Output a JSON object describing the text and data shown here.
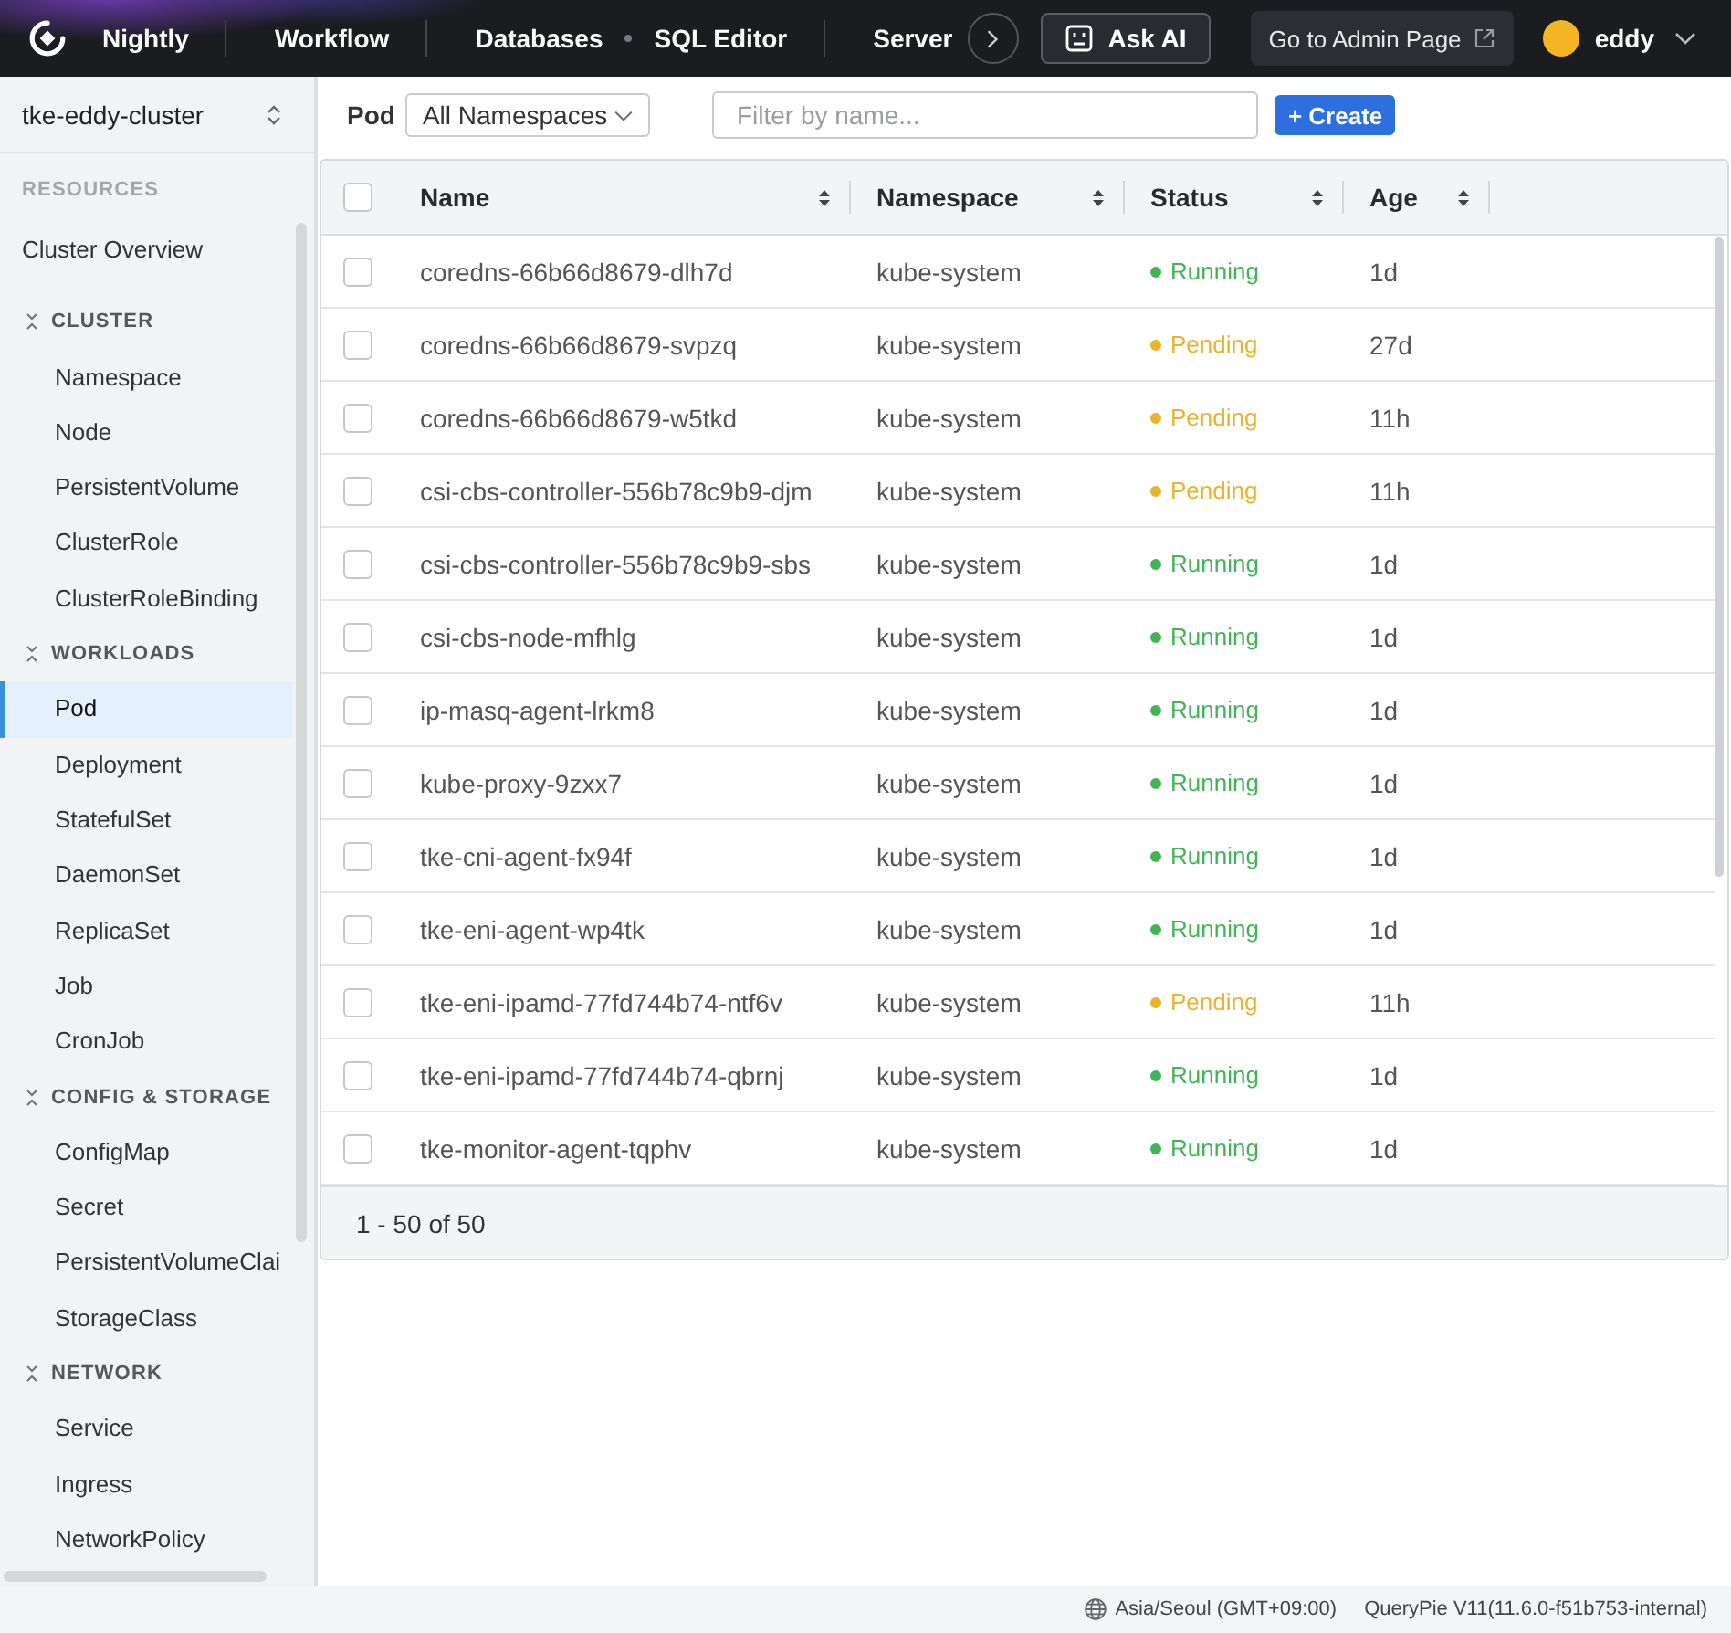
{
  "top_bar": {
    "brand": "Nightly",
    "nav_groups": [
      {
        "items": [
          {
            "label": "Workflow",
            "selected": false
          }
        ]
      },
      {
        "items": [
          {
            "label": "Databases",
            "selected": false
          },
          {
            "label": "SQL Editor",
            "selected": false
          }
        ]
      },
      {
        "items": [
          {
            "label": "Server",
            "selected": false
          }
        ]
      }
    ],
    "ask_ai": "Ask AI",
    "admin_link": "Go to Admin Page",
    "user": {
      "name": "eddy"
    }
  },
  "sidebar": {
    "cluster": "tke-eddy-cluster",
    "heading": "RESOURCES",
    "items": [
      {
        "label": "Cluster Overview",
        "selected": false
      }
    ],
    "sections": [
      {
        "title": "CLUSTER",
        "expanded": true,
        "items": [
          {
            "label": "Namespace",
            "selected": false
          },
          {
            "label": "Node",
            "selected": false
          },
          {
            "label": "PersistentVolume",
            "selected": false
          },
          {
            "label": "ClusterRole",
            "selected": false
          },
          {
            "label": "ClusterRoleBinding",
            "selected": false
          }
        ]
      },
      {
        "title": "WORKLOADS",
        "expanded": true,
        "items": [
          {
            "label": "Pod",
            "selected": true
          },
          {
            "label": "Deployment",
            "selected": false
          },
          {
            "label": "StatefulSet",
            "selected": false
          },
          {
            "label": "DaemonSet",
            "selected": false
          },
          {
            "label": "ReplicaSet",
            "selected": false
          },
          {
            "label": "Job",
            "selected": false
          },
          {
            "label": "CronJob",
            "selected": false
          }
        ]
      },
      {
        "title": "CONFIG & STORAGE",
        "expanded": true,
        "items": [
          {
            "label": "ConfigMap",
            "selected": false
          },
          {
            "label": "Secret",
            "selected": false
          },
          {
            "label": "PersistentVolumeClai",
            "selected": false
          },
          {
            "label": "StorageClass",
            "selected": false
          }
        ]
      },
      {
        "title": "NETWORK",
        "expanded": true,
        "items": [
          {
            "label": "Service",
            "selected": false
          },
          {
            "label": "Ingress",
            "selected": false
          },
          {
            "label": "NetworkPolicy",
            "selected": false
          }
        ]
      }
    ]
  },
  "toolbar": {
    "title": "Pod",
    "namespace_select": {
      "value": "All Namespaces"
    },
    "filter": {
      "placeholder": "Filter by name..."
    },
    "create_button": "+ Create"
  },
  "table": {
    "header_checkbox": {
      "checked": false
    },
    "columns": [
      {
        "label": "Name"
      },
      {
        "label": "Namespace"
      },
      {
        "label": "Status"
      },
      {
        "label": "Age"
      }
    ],
    "rows": [
      {
        "checked": false,
        "name": "coredns-66b66d8679-dlh7d",
        "namespace": "kube-system",
        "status": "Running",
        "color": "#41b556",
        "age": "1d"
      },
      {
        "checked": false,
        "name": "coredns-66b66d8679-svpzq",
        "namespace": "kube-system",
        "status": "Pending",
        "color": "#ebb22b",
        "age": "27d"
      },
      {
        "checked": false,
        "name": "coredns-66b66d8679-w5tkd",
        "namespace": "kube-system",
        "status": "Pending",
        "color": "#ebb22b",
        "age": "11h"
      },
      {
        "checked": false,
        "name": "csi-cbs-controller-556b78c9b9-djm",
        "namespace": "kube-system",
        "status": "Pending",
        "color": "#ebb22b",
        "age": "11h"
      },
      {
        "checked": false,
        "name": "csi-cbs-controller-556b78c9b9-sbs",
        "namespace": "kube-system",
        "status": "Running",
        "color": "#41b556",
        "age": "1d"
      },
      {
        "checked": false,
        "name": "csi-cbs-node-mfhlg",
        "namespace": "kube-system",
        "status": "Running",
        "color": "#41b556",
        "age": "1d"
      },
      {
        "checked": false,
        "name": "ip-masq-agent-lrkm8",
        "namespace": "kube-system",
        "status": "Running",
        "color": "#41b556",
        "age": "1d"
      },
      {
        "checked": false,
        "name": "kube-proxy-9zxx7",
        "namespace": "kube-system",
        "status": "Running",
        "color": "#41b556",
        "age": "1d"
      },
      {
        "checked": false,
        "name": "tke-cni-agent-fx94f",
        "namespace": "kube-system",
        "status": "Running",
        "color": "#41b556",
        "age": "1d"
      },
      {
        "checked": false,
        "name": "tke-eni-agent-wp4tk",
        "namespace": "kube-system",
        "status": "Running",
        "color": "#41b556",
        "age": "1d"
      },
      {
        "checked": false,
        "name": "tke-eni-ipamd-77fd744b74-ntf6v",
        "namespace": "kube-system",
        "status": "Pending",
        "color": "#ebb22b",
        "age": "11h"
      },
      {
        "checked": false,
        "name": "tke-eni-ipamd-77fd744b74-qbrnj",
        "namespace": "kube-system",
        "status": "Running",
        "color": "#41b556",
        "age": "1d"
      },
      {
        "checked": false,
        "name": "tke-monitor-agent-tqphv",
        "namespace": "kube-system",
        "status": "Running",
        "color": "#41b556",
        "age": "1d"
      }
    ],
    "footer": "1 - 50 of 50"
  },
  "status_bar": {
    "timezone": "Asia/Seoul (GMT+09:00)",
    "version": "QueryPie V11(11.6.0-f51b753-internal)"
  }
}
